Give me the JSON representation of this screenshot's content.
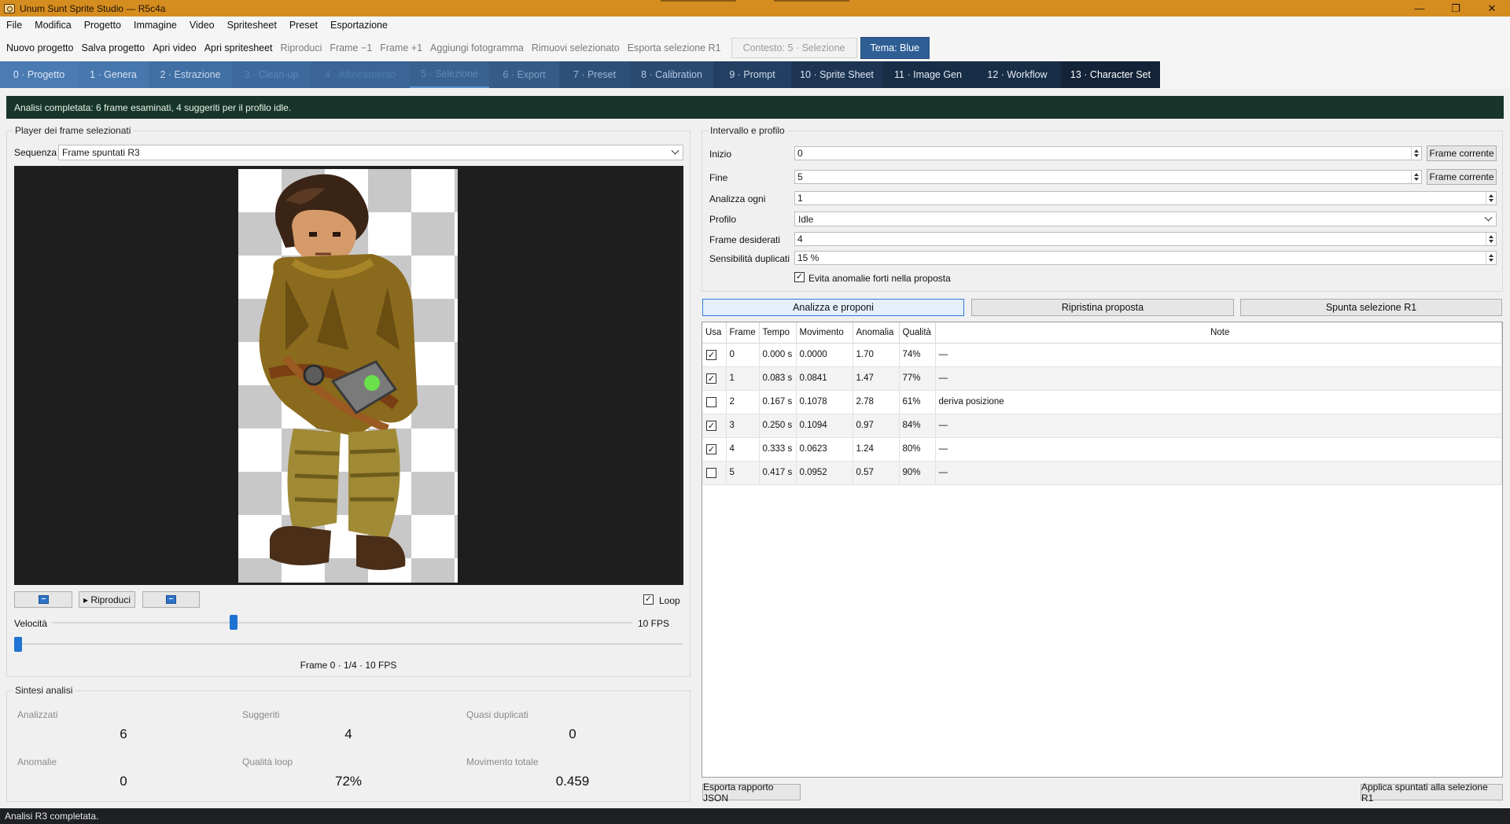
{
  "window": {
    "title": "Unum Sunt Sprite Studio — R5c4a",
    "minimize": "—",
    "maximize": "❐",
    "close": "✕"
  },
  "menu": [
    "File",
    "Modifica",
    "Progetto",
    "Immagine",
    "Video",
    "Spritesheet",
    "Preset",
    "Esportazione"
  ],
  "toolbar": {
    "new_project": "Nuovo progetto",
    "save_project": "Salva progetto",
    "open_video": "Apri video",
    "open_spritesheet": "Apri spritesheet",
    "play": "Riproduci",
    "frame_prev": "Frame −1",
    "frame_next": "Frame +1",
    "add_frame": "Aggiungi fotogramma",
    "remove_selected": "Rimuovi selezionato",
    "export_selection": "Esporta selezione R1",
    "context": "Contesto: 5 · Selezione",
    "theme": "Tema: Blue"
  },
  "steps": [
    "0 · Progetto",
    "1 · Genera",
    "2 · Estrazione",
    "3 · Clean-up",
    "4 · Allineamento",
    "5 · Selezione",
    "6 · Export",
    "7 · Preset",
    "8 · Calibration",
    "9 · Prompt",
    "10 · Sprite Sheet",
    "11 · Image Gen",
    "12 · Workflow",
    "13 · Character Set"
  ],
  "banner": "Analisi completata: 6 frame esaminati, 4 suggeriti per il profilo idle.",
  "player": {
    "group_title": "Player dei frame selezionati",
    "sequence_label": "Sequenza",
    "sequence_value": "Frame spuntati R3",
    "play_button": "▸ Riproduci",
    "loop_label": "Loop",
    "loop_checked": true,
    "speed_label": "Velocità",
    "speed_value": "10 FPS",
    "speed_fraction": 0.31,
    "position_fraction": 0.0,
    "frame_info": "Frame 0 · 1/4 · 10 FPS"
  },
  "summary": {
    "group_title": "Sintesi analisi",
    "items": [
      {
        "label": "Analizzati",
        "value": "6"
      },
      {
        "label": "Suggeriti",
        "value": "4"
      },
      {
        "label": "Quasi duplicati",
        "value": "0"
      },
      {
        "label": "Anomalie",
        "value": "0"
      },
      {
        "label": "Qualità loop",
        "value": "72%"
      },
      {
        "label": "Movimento totale",
        "value": "0.459"
      }
    ]
  },
  "range": {
    "group_title": "Intervallo e profilo",
    "start_label": "Inizio",
    "start_value": "0",
    "end_label": "Fine",
    "end_value": "5",
    "current_frame_button": "Frame corrente",
    "step_label": "Analizza ogni",
    "step_value": "1",
    "profile_label": "Profilo",
    "profile_value": "Idle",
    "desired_label": "Frame desiderati",
    "desired_value": "4",
    "dup_label": "Sensibilità duplicati",
    "dup_value": "15 %",
    "avoid_label": "Evita anomalie forti nella proposta",
    "avoid_checked": true
  },
  "actions": {
    "analyze": "Analizza e proponi",
    "reset": "Ripristina proposta",
    "check_r1": "Spunta selezione R1",
    "export_json": "Esporta rapporto JSON",
    "apply": "Applica spuntati alla selezione R1"
  },
  "table": {
    "headers": [
      "Usa",
      "Frame",
      "Tempo",
      "Movimento",
      "Anomalia",
      "Qualità",
      "Note"
    ],
    "rows": [
      {
        "use": true,
        "frame": "0",
        "time": "0.000 s",
        "move": "0.0000",
        "anomaly": "1.70",
        "quality": "74%",
        "note": "—"
      },
      {
        "use": true,
        "frame": "1",
        "time": "0.083 s",
        "move": "0.0841",
        "anomaly": "1.47",
        "quality": "77%",
        "note": "—"
      },
      {
        "use": false,
        "frame": "2",
        "time": "0.167 s",
        "move": "0.1078",
        "anomaly": "2.78",
        "quality": "61%",
        "note": "deriva posizione"
      },
      {
        "use": true,
        "frame": "3",
        "time": "0.250 s",
        "move": "0.1094",
        "anomaly": "0.97",
        "quality": "84%",
        "note": "—"
      },
      {
        "use": true,
        "frame": "4",
        "time": "0.333 s",
        "move": "0.0623",
        "anomaly": "1.24",
        "quality": "80%",
        "note": "—"
      },
      {
        "use": false,
        "frame": "5",
        "time": "0.417 s",
        "move": "0.0952",
        "anomaly": "0.57",
        "quality": "90%",
        "note": "—"
      }
    ]
  },
  "status": "Analisi R3 completata.",
  "colors": {
    "titlebar": "#d68d1f",
    "banner": "#17352a",
    "accent": "#1f73d2",
    "theme": "#2f5e95"
  },
  "icons": {
    "first_frame": "skip-back-icon",
    "last_frame": "skip-forward-icon",
    "checkmark": "✓"
  }
}
